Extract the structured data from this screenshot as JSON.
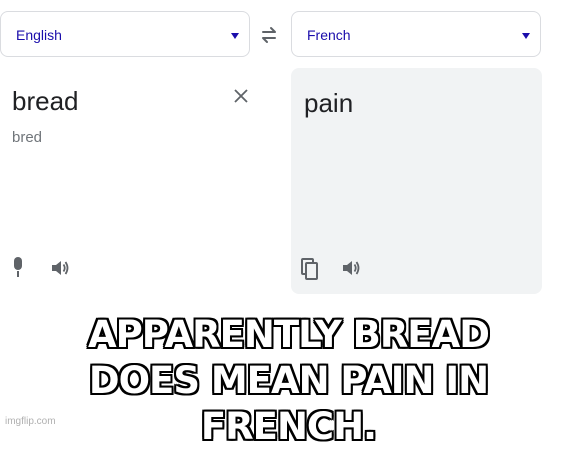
{
  "translator": {
    "source_language": "English",
    "target_language": "French",
    "source_text": "bread",
    "source_phonetic": "bred",
    "translated_text": "pain"
  },
  "icons": {
    "language_caret": "chevron-down-icon",
    "swap": "swap-languages-icon",
    "clear": "close-icon",
    "microphone": "microphone-icon",
    "speaker": "speaker-icon",
    "copy": "copy-icon"
  },
  "caption": {
    "line1": "APPARENTLY BREAD",
    "line2": "DOES MEAN PAIN IN FRENCH."
  },
  "watermark": "imgflip.com",
  "colors": {
    "accent": "#1a0dab",
    "icon_gray": "#5f6368",
    "panel_bg": "#f1f3f4",
    "caption_fill": "#ffffff",
    "caption_stroke": "#000000"
  }
}
